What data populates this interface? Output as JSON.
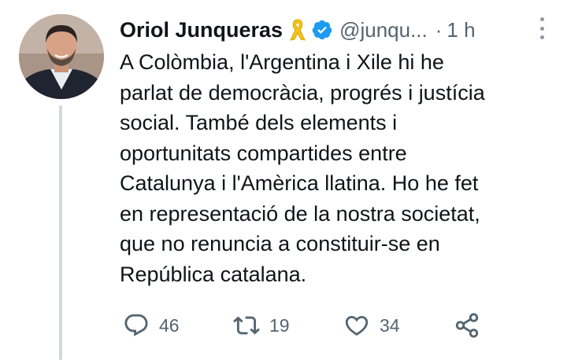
{
  "author": {
    "name": "Oriol Junqueras",
    "handle": "@junqu...",
    "separator": "·",
    "time": "1 h"
  },
  "icons": {
    "ribbon": "yellow-ribbon-icon",
    "verified": "verified-badge-icon",
    "more": "more-options-icon",
    "reply": "reply-icon",
    "retweet": "retweet-icon",
    "like": "like-icon",
    "share": "share-icon"
  },
  "colors": {
    "verified": "#1d9bf0",
    "ribbon": "#f5c518",
    "secondary_text": "#536471",
    "thread_line": "#cfd9de"
  },
  "tweet": {
    "lines": [
      "A Colòmbia, l'Argentina i Xile hi he",
      "parlat de democràcia, progrés i justícia",
      "social. També dels elements i",
      "oportunitats compartides entre",
      "Catalunya i l'Amèrica llatina. Ho he fet",
      "en representació de la nostra societat,",
      "que no renuncia a constituir-se en",
      "República catalana."
    ]
  },
  "actions": {
    "reply_count": "46",
    "retweet_count": "19",
    "like_count": "34"
  }
}
